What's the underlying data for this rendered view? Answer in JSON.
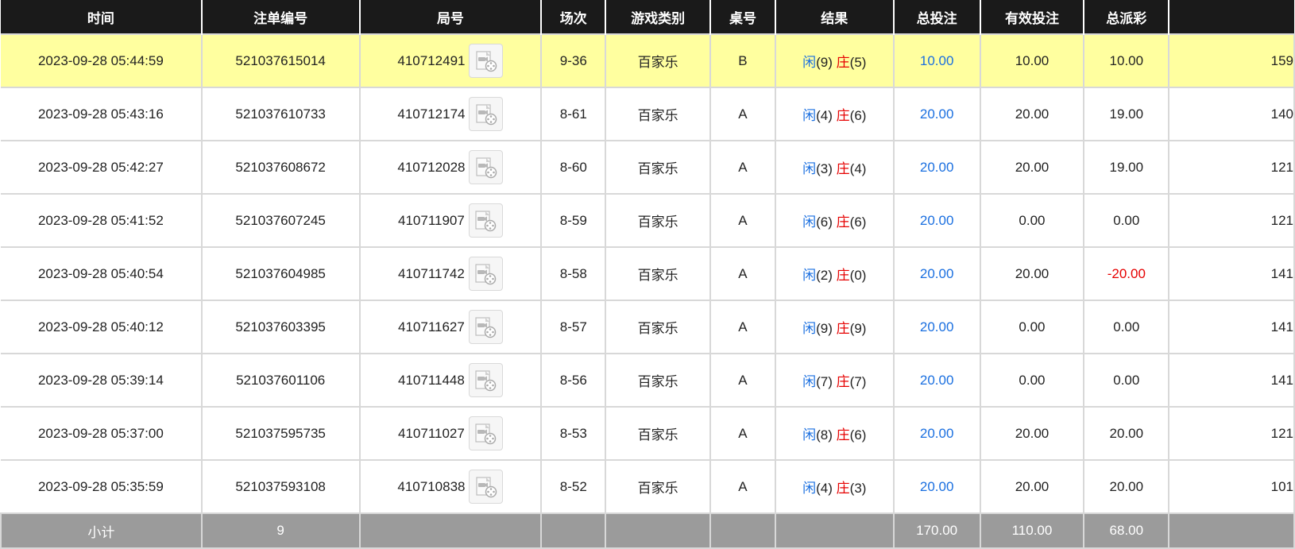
{
  "columns": [
    "时间",
    "注单编号",
    "局号",
    "场次",
    "游戏类别",
    "桌号",
    "结果",
    "总投注",
    "有效投注",
    "总派彩",
    ""
  ],
  "result_labels": {
    "player": "闲",
    "banker": "庄"
  },
  "rows": [
    {
      "time": "2023-09-28 05:44:59",
      "bet_no": "521037615014",
      "round": "410712491",
      "session": "9-36",
      "game": "百家乐",
      "table": "B",
      "player": "(9)",
      "banker": "(5)",
      "total_bet": "10.00",
      "valid_bet": "10.00",
      "payout": "10.00",
      "payout_negative": false,
      "balance": "159",
      "highlight": true
    },
    {
      "time": "2023-09-28 05:43:16",
      "bet_no": "521037610733",
      "round": "410712174",
      "session": "8-61",
      "game": "百家乐",
      "table": "A",
      "player": "(4)",
      "banker": "(6)",
      "total_bet": "20.00",
      "valid_bet": "20.00",
      "payout": "19.00",
      "payout_negative": false,
      "balance": "140",
      "highlight": false
    },
    {
      "time": "2023-09-28 05:42:27",
      "bet_no": "521037608672",
      "round": "410712028",
      "session": "8-60",
      "game": "百家乐",
      "table": "A",
      "player": "(3)",
      "banker": "(4)",
      "total_bet": "20.00",
      "valid_bet": "20.00",
      "payout": "19.00",
      "payout_negative": false,
      "balance": "121",
      "highlight": false
    },
    {
      "time": "2023-09-28 05:41:52",
      "bet_no": "521037607245",
      "round": "410711907",
      "session": "8-59",
      "game": "百家乐",
      "table": "A",
      "player": "(6)",
      "banker": "(6)",
      "total_bet": "20.00",
      "valid_bet": "0.00",
      "payout": "0.00",
      "payout_negative": false,
      "balance": "121",
      "highlight": false
    },
    {
      "time": "2023-09-28 05:40:54",
      "bet_no": "521037604985",
      "round": "410711742",
      "session": "8-58",
      "game": "百家乐",
      "table": "A",
      "player": "(2)",
      "banker": "(0)",
      "total_bet": "20.00",
      "valid_bet": "20.00",
      "payout": "-20.00",
      "payout_negative": true,
      "balance": "141",
      "highlight": false
    },
    {
      "time": "2023-09-28 05:40:12",
      "bet_no": "521037603395",
      "round": "410711627",
      "session": "8-57",
      "game": "百家乐",
      "table": "A",
      "player": "(9)",
      "banker": "(9)",
      "total_bet": "20.00",
      "valid_bet": "0.00",
      "payout": "0.00",
      "payout_negative": false,
      "balance": "141",
      "highlight": false
    },
    {
      "time": "2023-09-28 05:39:14",
      "bet_no": "521037601106",
      "round": "410711448",
      "session": "8-56",
      "game": "百家乐",
      "table": "A",
      "player": "(7)",
      "banker": "(7)",
      "total_bet": "20.00",
      "valid_bet": "0.00",
      "payout": "0.00",
      "payout_negative": false,
      "balance": "141",
      "highlight": false
    },
    {
      "time": "2023-09-28 05:37:00",
      "bet_no": "521037595735",
      "round": "410711027",
      "session": "8-53",
      "game": "百家乐",
      "table": "A",
      "player": "(8)",
      "banker": "(6)",
      "total_bet": "20.00",
      "valid_bet": "20.00",
      "payout": "20.00",
      "payout_negative": false,
      "balance": "121",
      "highlight": false
    },
    {
      "time": "2023-09-28 05:35:59",
      "bet_no": "521037593108",
      "round": "410710838",
      "session": "8-52",
      "game": "百家乐",
      "table": "A",
      "player": "(4)",
      "banker": "(3)",
      "total_bet": "20.00",
      "valid_bet": "20.00",
      "payout": "20.00",
      "payout_negative": false,
      "balance": "101",
      "highlight": false
    }
  ],
  "subtotal": {
    "label": "小计",
    "count": "9",
    "total_bet": "170.00",
    "valid_bet": "110.00",
    "payout": "68.00"
  },
  "icons": {
    "replay": "video-replay-icon"
  },
  "colors": {
    "header_bg": "#1a1a1a",
    "highlight_row": "#ffff9f",
    "blue": "#1a6fe0",
    "red": "#e60000",
    "subtotal_bg": "#9b9b9b"
  }
}
